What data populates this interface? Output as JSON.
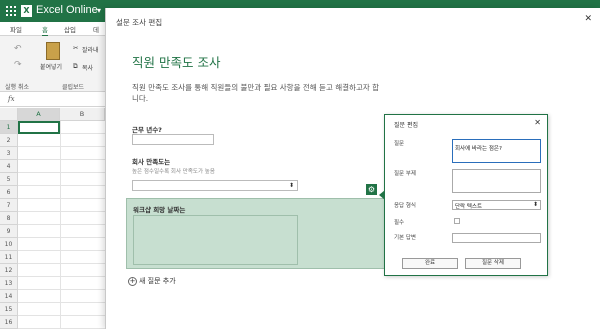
{
  "excel": {
    "brand": "Excel Online",
    "tabs": [
      "파일",
      "홈",
      "삽입",
      "데"
    ],
    "ribbon": {
      "undo_label": "실행 취소",
      "paste_label": "붙여넣기",
      "cut_label": "잘라내",
      "copy_label": "복사",
      "clipboard_group": "클립보드"
    },
    "formula_icon": "fx",
    "columns": [
      "A",
      "B"
    ],
    "rows": [
      "1",
      "2",
      "3",
      "4",
      "5",
      "6",
      "7",
      "8",
      "9",
      "10",
      "11",
      "12",
      "13",
      "14",
      "15",
      "16"
    ]
  },
  "dialog": {
    "title": "설문 조사 편집",
    "survey_title": "직원 만족도 조사",
    "survey_description": "직원 만족도 조사를 통해 직원들의 불만과 필요 사항을 전해 듣고 해결하고자 합니다.",
    "questions": [
      {
        "label": "근무 년수?"
      },
      {
        "label": "회사 만족도는",
        "hint": "높은 점수일수록 회사 만족도가 높음"
      },
      {
        "label": "워크샵 희망 날짜는"
      }
    ],
    "add_question_label": "새 질문 추가"
  },
  "edit_panel": {
    "title": "질문 편집",
    "question_label": "질문",
    "question_value": "회사에 바라는 점은?",
    "subtitle_label": "질문 부제",
    "response_type_label": "응답 형식",
    "response_type_value": "단락 텍스트",
    "required_label": "필수",
    "default_answer_label": "기본 답변",
    "done_button": "완료",
    "delete_button": "질문 삭제"
  },
  "colors": {
    "excel_green": "#217346",
    "selected_question_bg": "#c7dfd0"
  }
}
